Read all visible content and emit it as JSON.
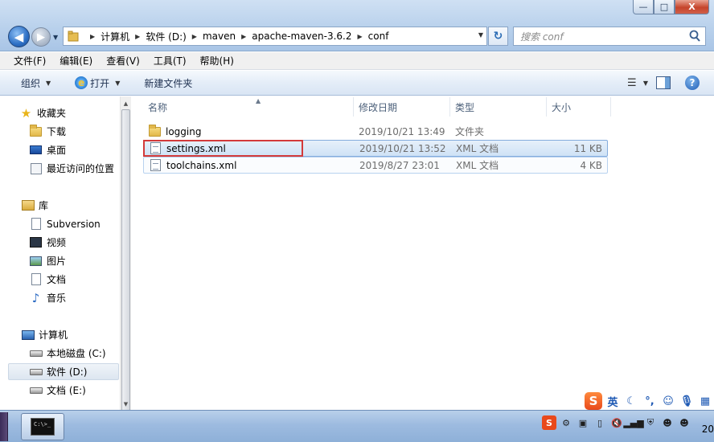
{
  "window": {
    "buttons": {
      "minimize": "—",
      "maximize": "□",
      "close": "X"
    }
  },
  "address_bar": {
    "breadcrumbs": [
      "计算机",
      "软件 (D:)",
      "maven",
      "apache-maven-3.6.2",
      "conf"
    ]
  },
  "search": {
    "placeholder": "搜索 conf"
  },
  "menu": [
    "文件(F)",
    "编辑(E)",
    "查看(V)",
    "工具(T)",
    "帮助(H)"
  ],
  "commands": {
    "organize": "组织",
    "open": "打开",
    "new_folder": "新建文件夹"
  },
  "nav": {
    "favorites": {
      "label": "收藏夹",
      "items": [
        "下载",
        "桌面",
        "最近访问的位置"
      ]
    },
    "libraries": {
      "label": "库",
      "items": [
        "Subversion",
        "视频",
        "图片",
        "文档",
        "音乐"
      ]
    },
    "computer": {
      "label": "计算机",
      "items": [
        "本地磁盘 (C:)",
        "软件 (D:)",
        "文档 (E:)"
      ]
    },
    "selected": "软件 (D:)"
  },
  "columns": {
    "name": "名称",
    "date": "修改日期",
    "type": "类型",
    "size": "大小"
  },
  "files": [
    {
      "name": "logging",
      "date": "2019/10/21 13:49",
      "type": "文件夹",
      "size": "",
      "icon": "folder-icon"
    },
    {
      "name": "settings.xml",
      "date": "2019/10/21 13:52",
      "type": "XML 文档",
      "size": "11 KB",
      "icon": "xml-file-icon"
    },
    {
      "name": "toolchains.xml",
      "date": "2019/8/27 23:01",
      "type": "XML 文档",
      "size": "4 KB",
      "icon": "xml-file-icon"
    }
  ],
  "selected_file": "settings.xml",
  "highlight_color": "#d33a3a",
  "taskbar": {
    "app_icon_text": "C:\\>_",
    "clock": "20"
  },
  "ime": {
    "logo": "S",
    "mode": "英"
  }
}
